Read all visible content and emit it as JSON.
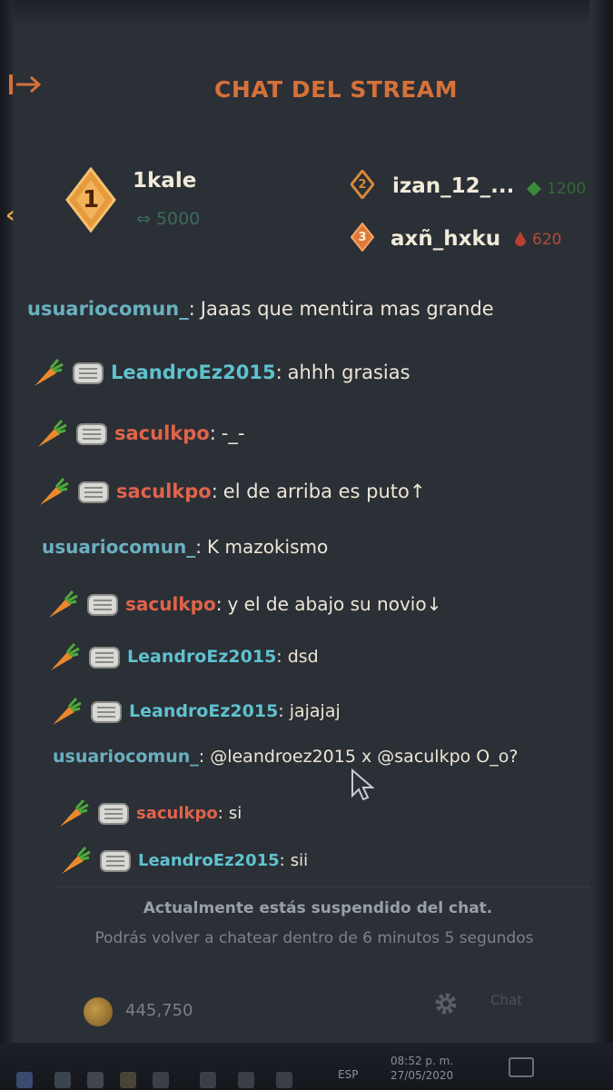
{
  "header": {
    "title": "CHAT DEL STREAM"
  },
  "leaderboard": [
    {
      "rank": "1",
      "name": "1kale",
      "score": "5000"
    },
    {
      "rank": "2",
      "name": "izan_12_...",
      "score": "1200"
    },
    {
      "rank": "3",
      "name": "axñ_hxku",
      "score": "620"
    }
  ],
  "messages": [
    {
      "user": "usuariocomun_",
      "text": "Jaaas que mentira mas grande",
      "badges": false
    },
    {
      "user": "LeandroEz2015",
      "text": "ahhh grasias",
      "badges": true
    },
    {
      "user": "saculkpo",
      "text": "-_-",
      "badges": true
    },
    {
      "user": "saculkpo",
      "text": "el de arriba es puto↑",
      "badges": true
    },
    {
      "user": "usuariocomun_",
      "text": "K mazokismo",
      "badges": false
    },
    {
      "user": "saculkpo",
      "text": "y el de abajo su novio↓",
      "badges": true
    },
    {
      "user": "LeandroEz2015",
      "text": "dsd",
      "badges": true
    },
    {
      "user": "LeandroEz2015",
      "text": "jajajaj",
      "badges": true
    },
    {
      "user": "usuariocomun_",
      "text": "@leandroez2015 x @saculkpo O_o?",
      "badges": false
    },
    {
      "user": "saculkpo",
      "text": "si",
      "badges": true
    },
    {
      "user": "LeandroEz2015",
      "text": "sii",
      "badges": true
    }
  ],
  "suspension": {
    "title": "Actualmente estás suspendido del chat.",
    "detail": "Podrás volver a chatear dentro de 6 minutos 5 segundos"
  },
  "footer": {
    "coins": "445,750",
    "chat_button": "Chat"
  },
  "taskbar": {
    "language": "ESP",
    "time": "08:52 p. m.",
    "date": "27/05/2020"
  },
  "colors": {
    "accent": "#d6713a",
    "user_common": "#6ab0c0",
    "user_leandro": "#5fc2ce",
    "user_saculk": "#e0644a"
  }
}
